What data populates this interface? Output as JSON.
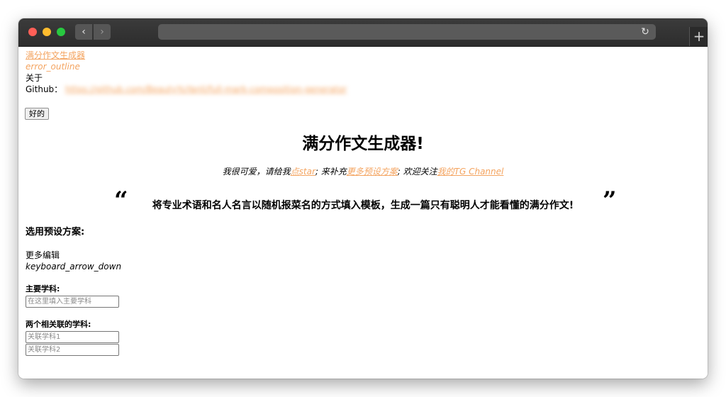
{
  "browser": {
    "back_glyph": "‹",
    "forward_glyph": "›",
    "reload_glyph": "↻",
    "newtab_glyph": "+"
  },
  "topinfo": {
    "app_link": "满分作文生成器",
    "error_text": "error_outline",
    "about_label": "关于",
    "github_label": "Github：",
    "github_url": "https://github.com/BeautyYuYanli/full-mark-composition-generator"
  },
  "ok_button_label": "好的",
  "page_title": "满分作文生成器!",
  "subtitle": {
    "part1": "我很可爱，请给我",
    "link1": "点star",
    "part2": "; 来补充",
    "link2": "更多预设方案",
    "part3": "; 欢迎关注",
    "link3": "我的TG Channel"
  },
  "quote": {
    "open": "“",
    "close": "”",
    "text": "将专业术语和名人名言以随机报菜名的方式填入模板，生成一篇只有聪明人才能看懂的满分作文!"
  },
  "preset_heading": "选用预设方案:",
  "more_edit_label": "更多编辑",
  "more_edit_icon_text": "keyboard_arrow_down",
  "main_subject": {
    "label": "主要学科:",
    "placeholder": "在这里填入主要学科"
  },
  "related_subjects": {
    "label": "两个相关联的学科:",
    "placeholder1": "关联学科1",
    "placeholder2": "关联学科2"
  },
  "colors": {
    "link": "#f4a460",
    "toolbar": "#2d2d2d"
  }
}
